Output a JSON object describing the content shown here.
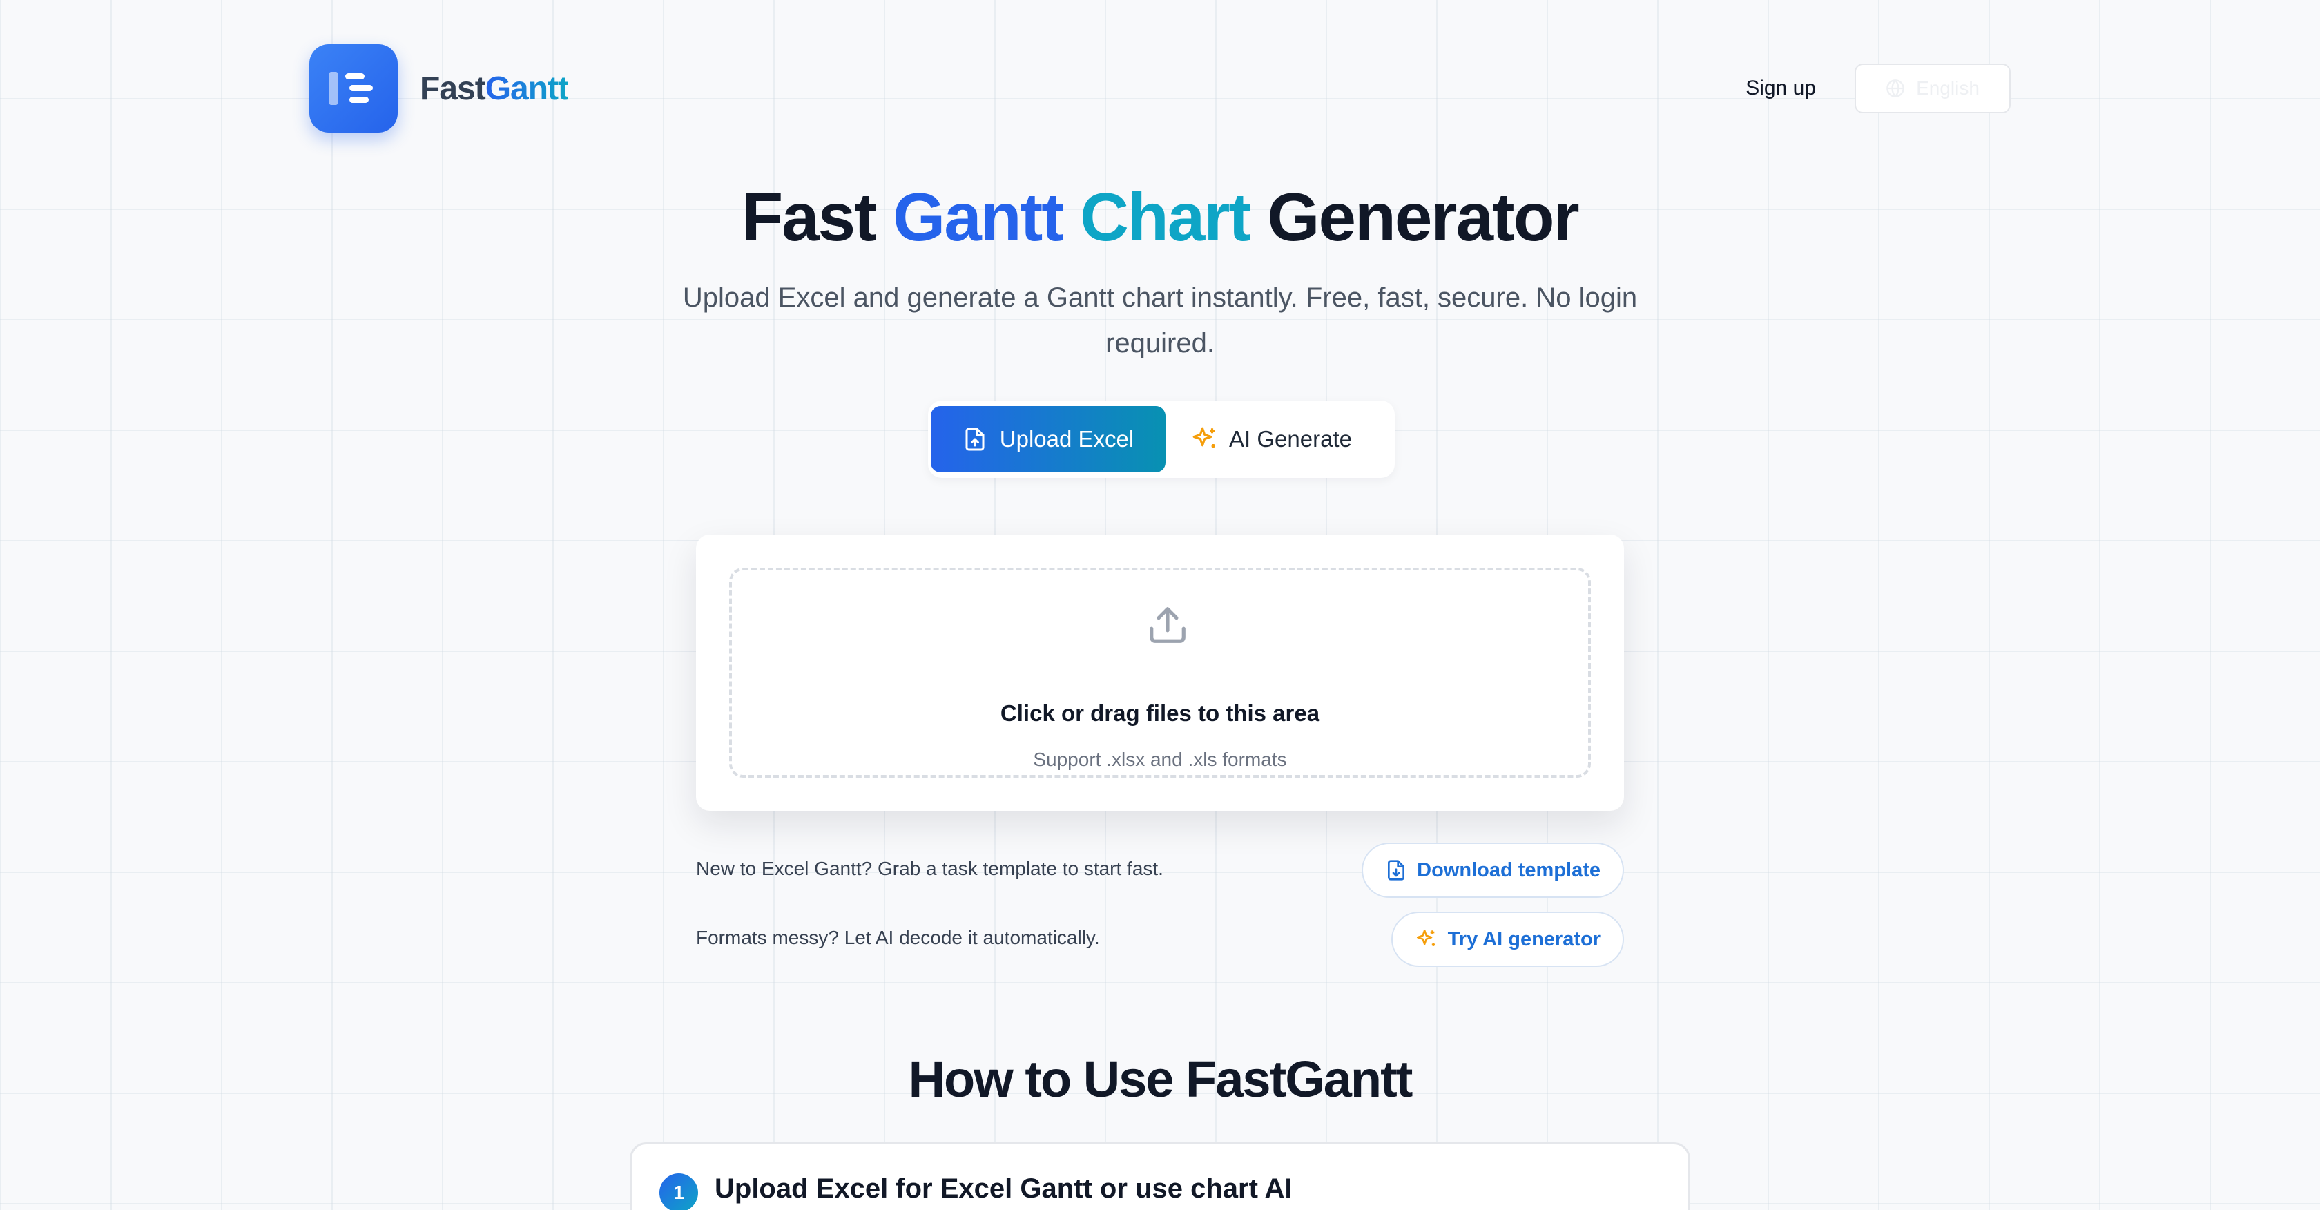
{
  "brand": {
    "name_part1": "Fast",
    "name_part2": "Gantt"
  },
  "nav": {
    "signup_label": "Sign up",
    "language_label": "English"
  },
  "hero": {
    "title_part1": "Fast ",
    "title_part2": "Gantt",
    "title_part3": " Chart",
    "title_part4": " Generator",
    "subtitle": "Upload Excel and generate a Gantt chart instantly. Free, fast, secure. No login required."
  },
  "mode_switch": {
    "upload_label": "Upload Excel",
    "ai_label": "AI Generate",
    "active": "upload"
  },
  "upload": {
    "title": "Click or drag files to this area",
    "hint": "Support .xlsx and .xls formats"
  },
  "helpers": [
    {
      "text": "New to Excel Gantt? Grab a task template to start fast.",
      "button": "Download template",
      "icon": "file-download-icon"
    },
    {
      "text": "Formats messy? Let AI decode it automatically.",
      "button": "Try AI generator",
      "icon": "sparkle-icon"
    }
  ],
  "howto": {
    "title": "How to Use FastGantt",
    "steps": [
      {
        "number": "1",
        "title": "Upload Excel for Excel Gantt or use chart AI"
      }
    ]
  },
  "colors": {
    "primary": "#2563eb",
    "accent": "#0ea5c6",
    "ai_icon": "#f59e0b",
    "text": "#111827"
  }
}
